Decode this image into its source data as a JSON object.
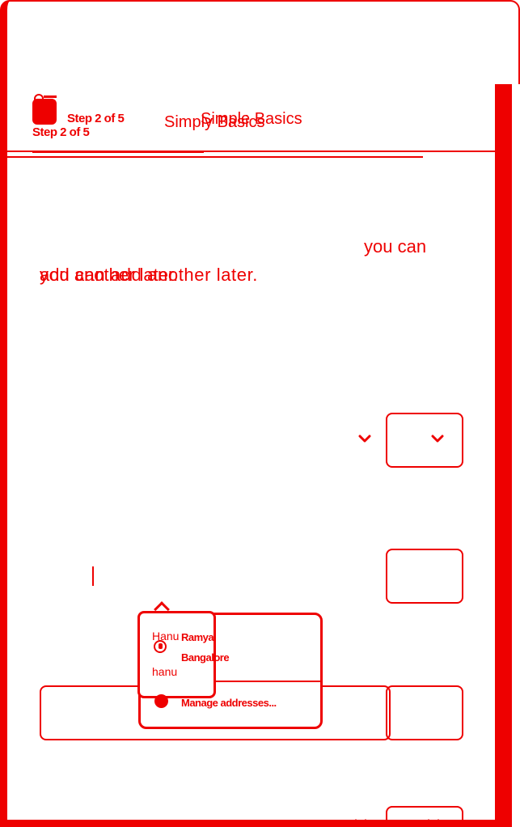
{
  "header": {
    "step_label_primary": "Step 2 of 5",
    "step_label_secondary": "Step 2 of 5",
    "title_primary": "Simple Basics",
    "title_secondary": "Simply Basics"
  },
  "intro": {
    "line_a": "you can",
    "line_b": "add another later.",
    "line_c": "you can add another later."
  },
  "autocomplete": {
    "name": "Ramya",
    "city": "Bangalore",
    "manage_label": "Manage addresses...",
    "hanu_cap": "Hanu",
    "hanu_lower": "hanu"
  },
  "icons": {
    "step": "step-badge-icon",
    "chevron": "chevron-down-icon",
    "person": "person-icon",
    "manage": "manage-icon"
  },
  "colors": {
    "accent": "#ee0000",
    "background": "#ffffff"
  }
}
